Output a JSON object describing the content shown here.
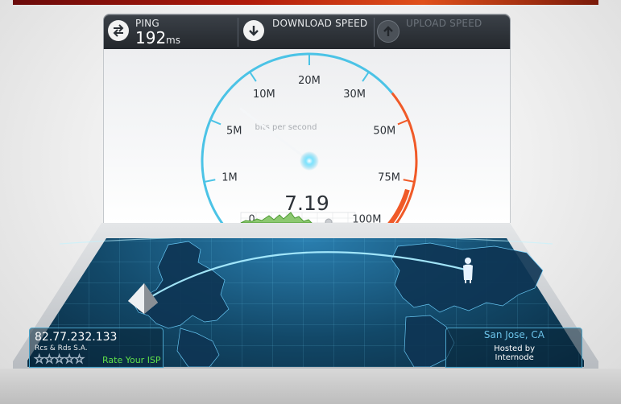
{
  "header": {
    "ping_label": "PING",
    "ping_value": "192",
    "ping_unit": "ms",
    "download_label": "DOWNLOAD SPEED",
    "upload_label": "UPLOAD SPEED"
  },
  "gauge": {
    "ticks": [
      "0",
      "1M",
      "5M",
      "10M",
      "20M",
      "30M",
      "50M",
      "75M",
      "100M"
    ],
    "unit_caption": "bits per second",
    "current_value": "7.19",
    "needle_value": 7.19,
    "arc_color": "#4bc3e6",
    "high_color": "#f05a28"
  },
  "map": {
    "ip_address": "82.77.232.133",
    "isp_name": "Rcs & Rds S.A.",
    "stars": "☆☆☆☆☆",
    "rate_label": "Rate Your ISP",
    "server_city": "San Jose, CA",
    "hosted_label": "Hosted by",
    "host_name": "Internode"
  },
  "icons": {
    "ping": "ping-arrows-icon",
    "download": "download-arrow-icon",
    "upload": "upload-arrow-icon",
    "server": "server-pyramid-icon",
    "user": "user-location-icon"
  }
}
